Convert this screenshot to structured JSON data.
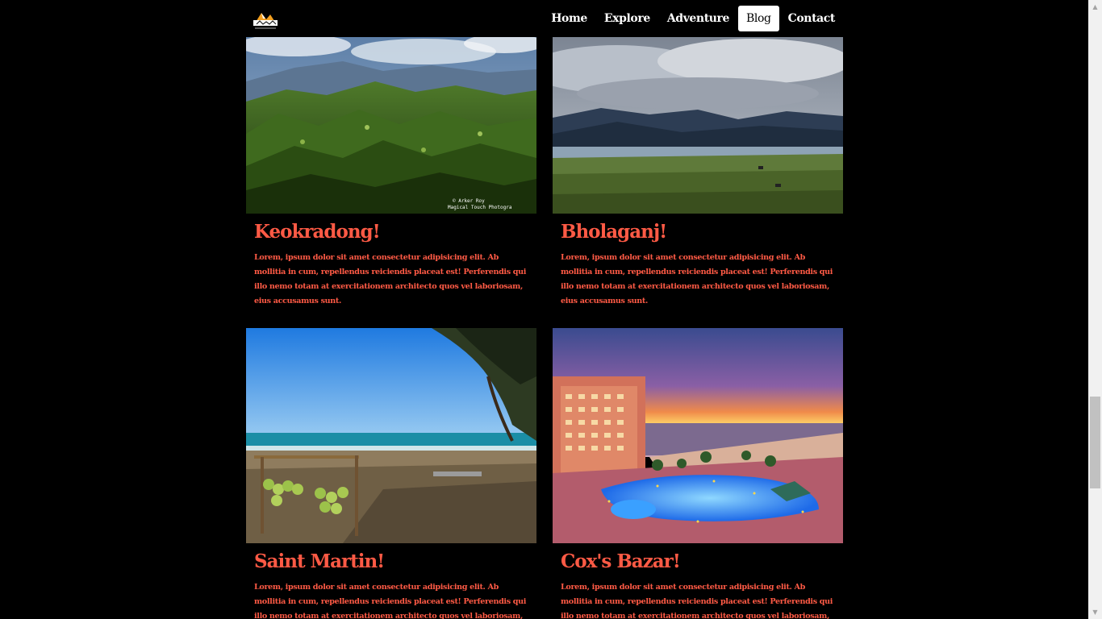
{
  "nav": {
    "items": [
      {
        "label": "Home"
      },
      {
        "label": "Explore"
      },
      {
        "label": "Adventure"
      },
      {
        "label": "Blog"
      },
      {
        "label": "Contact"
      }
    ],
    "active": "Blog"
  },
  "cards": [
    {
      "title": "Keokradong!",
      "text": "Lorem, ipsum dolor sit amet consectetur adipisicing elit. Ab mollitia in cum, repellendus reiciendis placeat est! Perferendis qui illo nemo totam at exercitationem architecto quos vel laboriosam, eius accusamus sunt.",
      "watermark": "© Arker Roy\nMagical Touch Photogra"
    },
    {
      "title": "Bholaganj!",
      "text": "Lorem, ipsum dolor sit amet consectetur adipisicing elit. Ab mollitia in cum, repellendus reiciendis placeat est! Perferendis qui illo nemo totam at exercitationem architecto quos vel laboriosam, eius accusamus sunt."
    },
    {
      "title": "Saint Martin!",
      "text": "Lorem, ipsum dolor sit amet consectetur adipisicing elit. Ab mollitia in cum, repellendus reiciendis placeat est! Perferendis qui illo nemo totam at exercitationem architecto quos vel laboriosam, eius accusamus sunt."
    },
    {
      "title": "Cox's Bazar!",
      "text": "Lorem, ipsum dolor sit amet consectetur adipisicing elit. Ab mollitia in cum, repellendus reiciendis placeat est! Perferendis qui illo nemo totam at exercitationem architecto quos vel laboriosam, eius accusamus sunt."
    }
  ],
  "colors": {
    "background": "#000000",
    "accent": "#ff5a45",
    "nav_text": "#ffffff"
  },
  "scroll_position": 0.64
}
